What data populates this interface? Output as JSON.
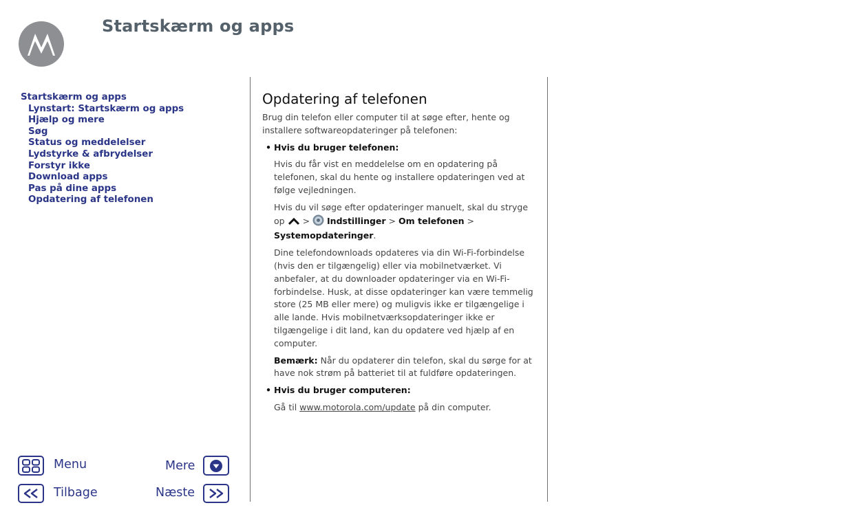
{
  "header": {
    "logo_icon": "motorola-logo",
    "title": "Startskærm og apps"
  },
  "toc": {
    "section": "Startskærm og apps",
    "items": [
      "Lynstart: Startskærm og apps",
      "Hjælp og mere",
      "Søg",
      "Status og meddelelser",
      "Lydstyrke & afbrydelser",
      "Forstyr ikke",
      "Download apps",
      "Pas på dine apps",
      "Opdatering af telefonen"
    ]
  },
  "nav": {
    "menu": "Menu",
    "more": "Mere",
    "back": "Tilbage",
    "next": "Næste"
  },
  "content": {
    "heading": "Opdatering af telefonen",
    "intro": "Brug din telefon eller computer til at søge efter, hente og installere softwareopdateringer på telefonen:",
    "phone_bullet": "Hvis du bruger telefonen:",
    "phone_para1": "Hvis du får vist en meddelelse om en opdatering på telefonen, skal du hente og installere opdateringen ved at følge vejledningen.",
    "phone_para2_prefix": "Hvis du vil søge efter opdateringer manuelt, skal du stryge op",
    "sep": ">",
    "settings": "Indstillinger",
    "about_phone": "Om telefonen",
    "system_updates": "Systemopdateringer",
    "period": ".",
    "phone_para3": "Dine telefondownloads opdateres via din Wi-Fi-forbindelse (hvis den er tilgængelig) eller via mobilnetværket. Vi anbefaler, at du downloader opdateringer via en Wi-Fi-forbindelse. Husk, at disse opdateringer kan være temmelig store (25 MB eller mere) og muligvis ikke er tilgængelige i alle lande. Hvis mobilnetværksopdateringer ikke er tilgængelige i dit land, kan du opdatere ved hjælp af en computer.",
    "note_label": "Bemærk:",
    "note_text": "Når du opdaterer din telefon, skal du sørge for at have nok strøm på batteriet til at fuldføre opdateringen.",
    "computer_bullet": "Hvis du bruger computeren:",
    "computer_prefix": "Gå til",
    "computer_link": "www.motorola.com/update",
    "computer_suffix": "på din computer.",
    "bullet_char": "•"
  }
}
